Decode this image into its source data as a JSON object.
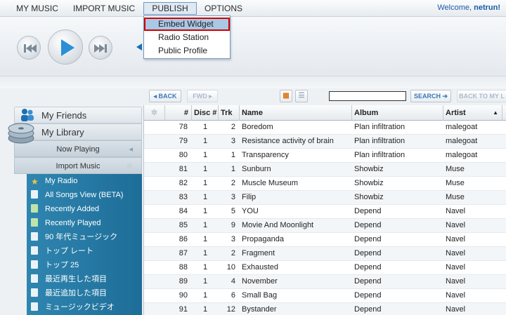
{
  "menu": {
    "items": [
      "MY MUSIC",
      "IMPORT MUSIC",
      "PUBLISH",
      "OPTIONS"
    ],
    "welcome_prefix": "Welcome,",
    "username": "netrun!"
  },
  "publish_menu": {
    "items": [
      "Embed Widget",
      "Radio Station",
      "Public Profile"
    ]
  },
  "player": {
    "prev_icon": "skip-back-icon",
    "play_icon": "play-icon",
    "next_icon": "skip-forward-icon"
  },
  "sidebar": {
    "friends_tab": "My Friends",
    "library_tab": "My Library",
    "now_playing": "Now Playing",
    "import_music": "Import Music",
    "items": [
      "My Radio",
      "All Songs View (BETA)",
      "Recently Added",
      "Recently Played",
      "90 年代ミュージック",
      "トップ レート",
      "トップ 25",
      "最近再生した項目",
      "最近追加した項目",
      "ミュージックビデオ"
    ]
  },
  "toolbar": {
    "back": "BACK",
    "fwd": "FWD",
    "search_button": "SEARCH",
    "back_to_my": "BACK TO MY L",
    "search_value": ""
  },
  "table": {
    "columns": [
      "#",
      "Disc #",
      "Trk",
      "Name",
      "Album",
      "Artist"
    ],
    "sort_indicator": "▲",
    "rows": [
      [
        "78",
        "1",
        "2",
        "Boredom",
        "Plan infiltration",
        "malegoat"
      ],
      [
        "79",
        "1",
        "3",
        "Resistance activity of brain",
        "Plan infiltration",
        "malegoat"
      ],
      [
        "80",
        "1",
        "1",
        "Transparency",
        "Plan infiltration",
        "malegoat"
      ],
      [
        "81",
        "1",
        "1",
        "Sunburn",
        "Showbiz",
        "Muse"
      ],
      [
        "82",
        "1",
        "2",
        "Muscle Museum",
        "Showbiz",
        "Muse"
      ],
      [
        "83",
        "1",
        "3",
        "Filip",
        "Showbiz",
        "Muse"
      ],
      [
        "84",
        "1",
        "5",
        "YOU",
        "Depend",
        "Navel"
      ],
      [
        "85",
        "1",
        "9",
        "Movie And Moonlight",
        "Depend",
        "Navel"
      ],
      [
        "86",
        "1",
        "3",
        "Propaganda",
        "Depend",
        "Navel"
      ],
      [
        "87",
        "1",
        "2",
        "Fragment",
        "Depend",
        "Navel"
      ],
      [
        "88",
        "1",
        "10",
        "Exhausted",
        "Depend",
        "Navel"
      ],
      [
        "89",
        "1",
        "4",
        "November",
        "Depend",
        "Navel"
      ],
      [
        "90",
        "1",
        "6",
        "Small Bag",
        "Depend",
        "Navel"
      ],
      [
        "91",
        "1",
        "12",
        "Bystander",
        "Depend",
        "Navel"
      ]
    ]
  },
  "colors": {
    "accent": "#1a5aa6",
    "highlight_border": "#d40000",
    "sidebar_list": "#2f86b0"
  }
}
